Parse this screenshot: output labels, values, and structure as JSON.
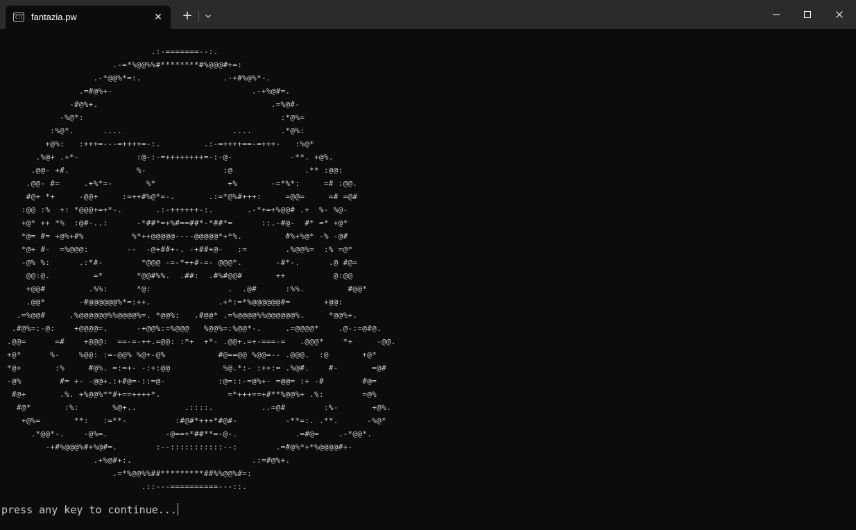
{
  "tab": {
    "title": "fantazia.pw",
    "icon": "terminal-icon",
    "icon_glyph": "C:\\"
  },
  "titlebar": {
    "new_tab_label": "+",
    "close_tab_label": "✕"
  },
  "terminal": {
    "ascii_art": "                              .:-=======--:.\n                      .-=*%@@%%#********#%@@@#+=:\n                  .-*@@%*=:.                 .-+#%@%*-.\n               .=#@%+-                             .-+%@#=.\n             -#@%+.                                    .=%@#-\n           -%@*:                                         :*@%=\n         :%@*.      ....                       ....      .*@%:\n        +@%:   :+++=---=++++=-:.         .:-=++++==-=+++-   :%@*\n      .%@+ .+*-            :@-:-=++++++++=-:-@-            -**. +@%.\n     .@@- +#.              %-                :@               .** :@@:\n    .@@- #=     .+%*=-       %*               +%       -=*%*:     =# :@@.\n    #@+ *+     -@@+     :=++#%@*=-.       .:=*@%#+++:     =@@=     =# =@#\n   :@@ :%  +: *@@@+=+*-.       .:-++++++-:.       .-*+=+%@@# .+  %- %@-\n   +@* ++ *%  :@#-..:      -*##*=+%#==##*-*##*=      ::.-#@-  #* =* +@*\n   *@= #= +@%+#%          %*++@@@@@----@@@@@*+*%.         #%+%@* -% -@#\n   *@+ #-  =%@@@:        --  -@+##+-. -+##+@-   :=        .%@@%=  :% =@*\n   -@% %:      .:*#-        *@@@ -=-*++#-=- @@@*.       -#*-.      .@ #@=\n    @@:@.         =*       *@@#%%.  .##:  .#%#@@#       ++          @:@@\n    +@@#         .%%:      *@:                .  .@#      :%%.         #@@*\n    .@@*       -#@@@@@@%*=:++.              .+*:=*%@@@@@@#=       +@@:\n  .=%@@#     .%@@@@@@%%@@@@%=. *@@%:   .#@@* .=%@@@@%%@@@@@@%.     *@@%+.\n .#@%=:-@:    +@@@@=.      -+@@%:=%@@@   %@@%=:%@@*-.     .=@@@@*    .@-:=@#@.\n.@@=      =#    +@@@:  ==-=-++.=@@: :*+  +*- .@@+.=+-===-=   .@@@*    *+     -@@.\n+@*      %-    %@@: :=-@@% %@+-@%           #@==@@ %@@=-- .@@@.  :@       +@*\n*@+       :%     #@%. =:=+- -:+:@@           %@.*:- :++:= .%@#.    #-       =@#\n-@%        #= +- -@@+.:+#@=-::=@-           :@=::-=@%+- =@@= :+ -#        #@=\n #@+       .%. +%@@%**#+==++++*.              =*+++==+#**%@@%+ .%:        =@%\n  #@*       :%:       %@+..          .::::.          ..=@#        :%-       +@%.\n   +@%=       **:   :=**-          :#@#*+++*#@#-          -**=:. .**.      -%@*\n     .*@@*-.    -@%=.            -@==+*##**=-@-.            .=#@=    .-*@@*.\n        -+#%@@@%#+%@#=.        :--:::::::::::--:        .=#@%*+*%@@@@#+-\n                  .+%@#+:.                         .:=#@%+.\n                      .=*%@@%%##*********##%%@@%#=:\n                            .::---==========---::.",
    "prompt": "press any key to continue..."
  }
}
